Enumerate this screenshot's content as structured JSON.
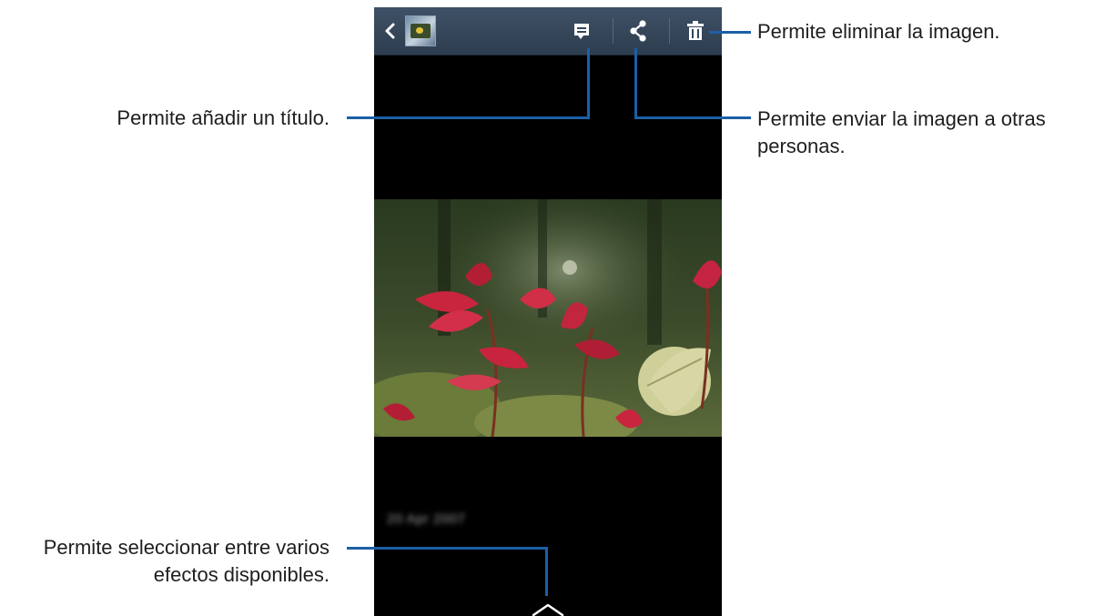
{
  "appbar": {
    "icons": [
      "back-arrow-icon",
      "album-thumbnail",
      "caption-icon",
      "share-icon",
      "delete-icon"
    ]
  },
  "photo": {
    "subject": "red-leaves-photo"
  },
  "date_text": "20 Apr 2007",
  "callouts": {
    "title": "Permite añadir un título.",
    "delete": "Permite eliminar la imagen.",
    "share_line1": "Permite enviar la imagen a otras",
    "share_line2": "personas.",
    "effects_line1": "Permite seleccionar entre varios",
    "effects_line2": "efectos disponibles."
  },
  "colors": {
    "callout_line": "#1c5fa5",
    "appbar": "#34465a",
    "screen_background": "#000000"
  }
}
